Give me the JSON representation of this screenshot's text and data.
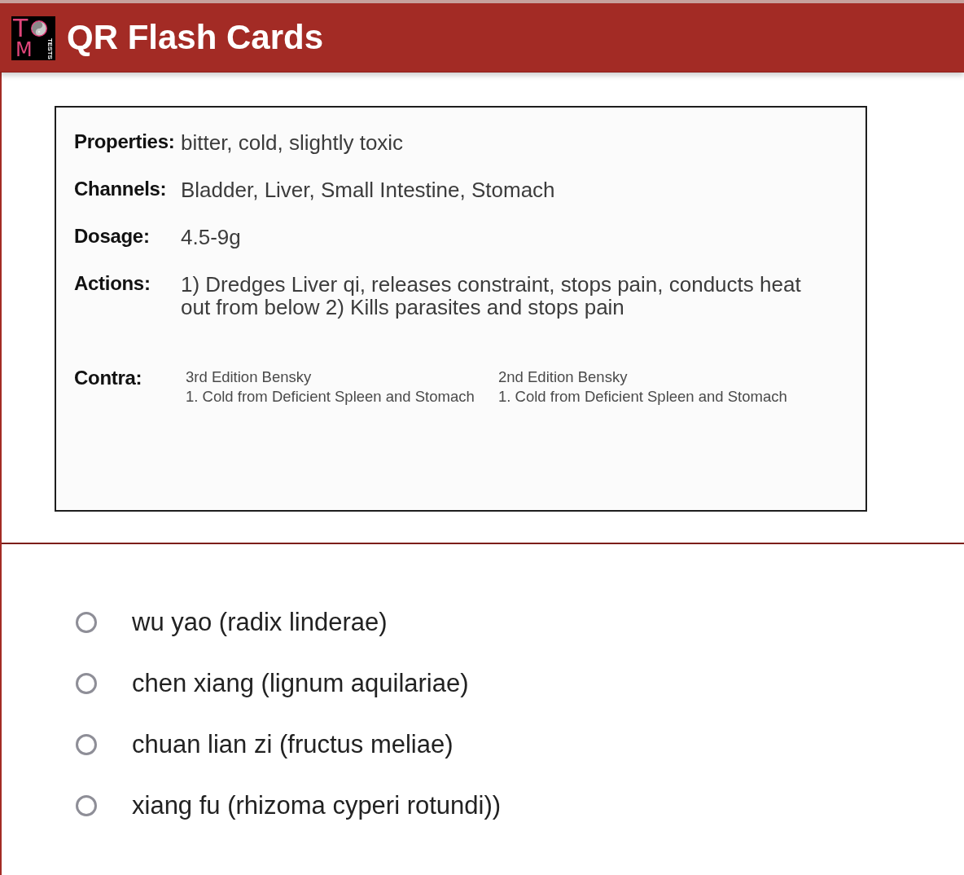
{
  "header": {
    "logo": {
      "letters": [
        "T",
        "M"
      ],
      "tagline": "TESTS"
    },
    "title": "QR Flash Cards"
  },
  "card": {
    "rows": [
      {
        "kind": "text",
        "label": "Properties:",
        "value": "bitter, cold, slightly toxic"
      },
      {
        "kind": "text",
        "label": "Channels:",
        "value": "Bladder, Liver, Small Intestine, Stomach"
      },
      {
        "kind": "text",
        "label": "Dosage:",
        "value": "4.5-9g"
      },
      {
        "kind": "text",
        "label": "Actions:",
        "value": "1) Dredges Liver qi, releases constraint, stops pain, conducts heat out from below 2) Kills parasites and stops pain"
      },
      {
        "kind": "editions",
        "label": "Contra:",
        "editions": [
          {
            "heading": "3rd Edition Bensky",
            "items": [
              "1. Cold from Deficient Spleen and Stomach"
            ]
          },
          {
            "heading": "2nd Edition Bensky",
            "items": [
              "1. Cold from Deficient Spleen and Stomach"
            ]
          }
        ]
      }
    ]
  },
  "options": [
    {
      "label": "wu yao (radix linderae)",
      "selected": false
    },
    {
      "label": "chen xiang (lignum aquilariae)",
      "selected": false
    },
    {
      "label": "chuan lian zi (fructus meliae)",
      "selected": false
    },
    {
      "label": "xiang fu (rhizoma cyperi rotundi))",
      "selected": false
    }
  ]
}
